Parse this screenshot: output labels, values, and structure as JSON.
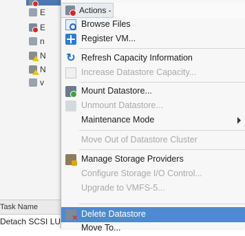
{
  "tree": {
    "rows": [
      {
        "letter": "",
        "icon": "datastore-red-icon"
      },
      {
        "letter": "E",
        "icon": "datastore-plain-icon"
      },
      {
        "letter": "E",
        "icon": "datastore-red-icon"
      },
      {
        "letter": "n",
        "icon": "datastore-plain-icon"
      },
      {
        "letter": "N",
        "icon": "datastore-warning-icon"
      },
      {
        "letter": "N",
        "icon": "datastore-warning-icon"
      },
      {
        "letter": "v",
        "icon": "datastore-plain-icon"
      }
    ]
  },
  "tasks": {
    "header": "Task Name",
    "row1": "Detach SCSI LU"
  },
  "menu": {
    "title": "Actions -",
    "items": [
      {
        "label": "Browse Files",
        "icon": "browse-files-icon"
      },
      {
        "label": "Register VM...",
        "icon": "register-vm-icon"
      },
      {
        "label": "Refresh Capacity Information",
        "icon": "refresh-icon"
      },
      {
        "label": "Increase Datastore Capacity...",
        "icon": "increase-capacity-icon"
      },
      {
        "label": "Mount Datastore...",
        "icon": "mount-datastore-icon"
      },
      {
        "label": "Unmount Datastore...",
        "icon": "unmount-datastore-icon"
      },
      {
        "label": "Maintenance Mode"
      },
      {
        "label": "Move Out of Datastore Cluster"
      },
      {
        "label": "Manage Storage Providers",
        "icon": "storage-providers-icon"
      },
      {
        "label": "Configure Storage I/O Control..."
      },
      {
        "label": "Upgrade to VMFS-5..."
      },
      {
        "label": "Delete Datastore",
        "icon": "delete-datastore-icon"
      },
      {
        "label": "Move To..."
      }
    ]
  }
}
